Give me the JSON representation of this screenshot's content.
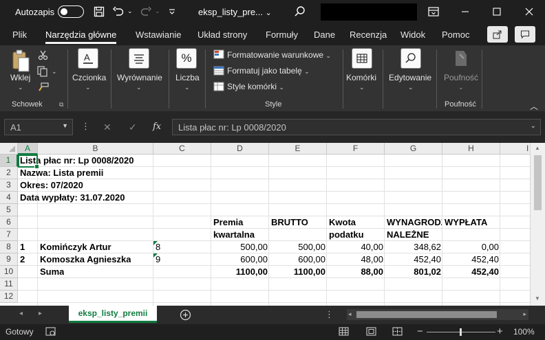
{
  "titlebar": {
    "autosave_label": "Autozapis",
    "doc_name": "eksp_listy_pre... ",
    "doc_name_chevron": "⌄"
  },
  "menu": {
    "tabs": [
      "Plik",
      "Narzędzia główne",
      "Wstawianie",
      "Układ strony",
      "Formuły",
      "Dane",
      "Recenzja",
      "Widok",
      "Pomoc"
    ],
    "active": "Narzędzia główne"
  },
  "ribbon": {
    "paste_label": "Wklej",
    "clipboard_group": "Schowek",
    "font_label": "Czcionka",
    "alignment_label": "Wyrównanie",
    "number_label": "Liczba",
    "number_icon_text": "%",
    "conditional_formatting": "Formatowanie warunkowe",
    "format_as_table": "Formatuj jako tabelę",
    "cell_styles": "Style komórki",
    "styles_group": "Style",
    "cells_label": "Komórki",
    "editing_label": "Edytowanie",
    "sensitivity_label": "Poufność",
    "sensitivity_group": "Poufność"
  },
  "formula_bar": {
    "name_box": "A1",
    "fx_label": "fx",
    "formula": "Lista płac nr: Lp 0008/2020"
  },
  "grid": {
    "columns": [
      "A",
      "B",
      "C",
      "D",
      "E",
      "F",
      "G",
      "H",
      "I"
    ],
    "rows": [
      "1",
      "2",
      "3",
      "4",
      "5",
      "6",
      "7",
      "8",
      "9",
      "10",
      "11",
      "12"
    ],
    "header_lines": [
      "Lista płac nr: Lp 0008/2020",
      "Nazwa: Lista premii",
      "Okres: 07/2020",
      "Data wypłaty: 31.07.2020"
    ],
    "col_headers_row6": [
      "Premia",
      "BRUTTO",
      "Kwota",
      "WYNAGRODZ",
      "WYPŁATA"
    ],
    "col_headers_row7": [
      "kwartalna",
      "",
      "podatku",
      "NALEŻNE",
      ""
    ],
    "data_rows": [
      {
        "lp": "1",
        "name": "Komińczyk Artur",
        "c": "8",
        "premia": "500,00",
        "brutto": "500,00",
        "podatek": "40,00",
        "nalezne": "348,62",
        "wyplata": "0,00"
      },
      {
        "lp": "2",
        "name": "Komoszka Agnieszka",
        "c": "9",
        "premia": "600,00",
        "brutto": "600,00",
        "podatek": "48,00",
        "nalezne": "452,40",
        "wyplata": "452,40"
      }
    ],
    "sum_row": {
      "label": "Suma",
      "premia": "1100,00",
      "brutto": "1100,00",
      "podatek": "88,00",
      "nalezne": "801,02",
      "wyplata": "452,40"
    }
  },
  "sheets": {
    "tabs": [
      "eksp_listy_premii"
    ],
    "active": "eksp_listy_premii"
  },
  "status": {
    "ready": "Gotowy",
    "zoom": "100%"
  },
  "colors": {
    "accent": "#107c41",
    "ribbon_bg": "#333333",
    "title_bg": "#1f1f1f"
  }
}
